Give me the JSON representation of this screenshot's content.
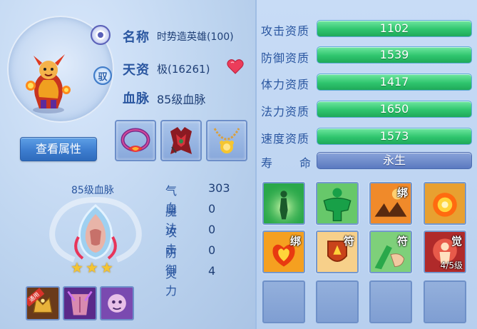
{
  "profile": {
    "name_label": "名称",
    "name_value": "时势造英雄(100)",
    "aptitude_label": "天资",
    "aptitude_value": "极(16261)",
    "bloodline_label": "血脉",
    "bloodline_value": "85级血脉",
    "role_badge": "驭",
    "view_button": "查看属性"
  },
  "bloodline": {
    "title": "85级血脉",
    "stars": 3,
    "stats": [
      {
        "label": "气血",
        "value": "303"
      },
      {
        "label": "魔法",
        "value": "0"
      },
      {
        "label": "攻击",
        "value": "0"
      },
      {
        "label": "防御",
        "value": "0"
      },
      {
        "label": "灵力",
        "value": "4"
      }
    ],
    "equip_tag": "通用"
  },
  "aptitudes": [
    {
      "label": "攻击资质",
      "value": "1102"
    },
    {
      "label": "防御资质",
      "value": "1539"
    },
    {
      "label": "体力资质",
      "value": "1417"
    },
    {
      "label": "法力资质",
      "value": "1650"
    },
    {
      "label": "速度资质",
      "value": "1573"
    }
  ],
  "lifespan": {
    "label_a": "寿",
    "label_b": "命",
    "value": "永生"
  },
  "skills": [
    {
      "icon": "green-figure-icon",
      "mark": ""
    },
    {
      "icon": "green-muscle-icon",
      "mark": ""
    },
    {
      "icon": "orange-claw-icon",
      "mark": "绑"
    },
    {
      "icon": "fireball-icon",
      "mark": ""
    },
    {
      "icon": "flame-heart-icon",
      "mark": "绑"
    },
    {
      "icon": "flame-shield-icon",
      "mark": "符"
    },
    {
      "icon": "green-hand-icon",
      "mark": "符"
    },
    {
      "icon": "red-aura-icon",
      "mark": "觉",
      "level": "4/5级"
    }
  ],
  "colors": {
    "label_blue": "#2a56a0",
    "bar_green": "#2fc56e",
    "bar_blue": "#5b79c0",
    "button_blue": "#3d7dcf"
  }
}
